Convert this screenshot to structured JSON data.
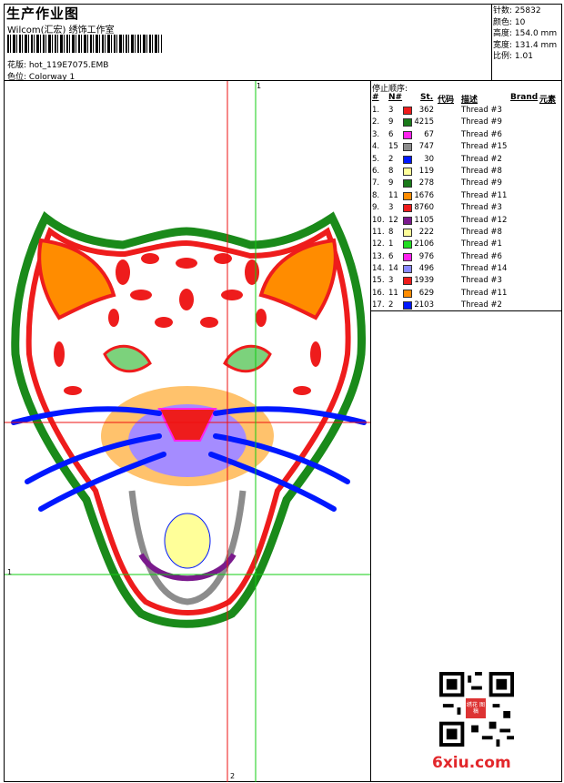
{
  "header": {
    "title": "生产作业图",
    "studio": "Wilcom(汇宏) 绣饰工作室",
    "design_label": "花版:",
    "design_file": "hot_119E7075.EMB",
    "colorway_label": "色位:",
    "colorway": "Colorway 1"
  },
  "stats": [
    {
      "label": "针数:",
      "value": "25832"
    },
    {
      "label": "颜色:",
      "value": "10"
    },
    {
      "label": "高度:",
      "value": "154.0 mm"
    },
    {
      "label": "宽度:",
      "value": "131.4 mm"
    },
    {
      "label": "比例:",
      "value": "1.01"
    }
  ],
  "sequence": {
    "title": "停止顺序:",
    "headers": {
      "num": "#",
      "n": "N#",
      "st": "St.",
      "code": "代码",
      "desc": "描述",
      "brand": "Brand",
      "elem": "元素"
    },
    "rows": [
      {
        "num": "1.",
        "n": "3",
        "color": "#ee1c1c",
        "st": "362",
        "desc": "Thread #3"
      },
      {
        "num": "2.",
        "n": "9",
        "color": "#1a7a1a",
        "st": "4215",
        "desc": "Thread #9"
      },
      {
        "num": "3.",
        "n": "6",
        "color": "#ff22ee",
        "st": "67",
        "desc": "Thread #6"
      },
      {
        "num": "4.",
        "n": "15",
        "color": "#8c8c8c",
        "st": "747",
        "desc": "Thread #15"
      },
      {
        "num": "5.",
        "n": "2",
        "color": "#0018ff",
        "st": "30",
        "desc": "Thread #2"
      },
      {
        "num": "6.",
        "n": "8",
        "color": "#ffff99",
        "st": "119",
        "desc": "Thread #8"
      },
      {
        "num": "7.",
        "n": "9",
        "color": "#1a7a1a",
        "st": "278",
        "desc": "Thread #9"
      },
      {
        "num": "8.",
        "n": "11",
        "color": "#ff8c00",
        "st": "1676",
        "desc": "Thread #11"
      },
      {
        "num": "9.",
        "n": "3",
        "color": "#ee1c1c",
        "st": "8760",
        "desc": "Thread #3"
      },
      {
        "num": "10.",
        "n": "12",
        "color": "#7a1a8c",
        "st": "1105",
        "desc": "Thread #12"
      },
      {
        "num": "11.",
        "n": "8",
        "color": "#ffff99",
        "st": "222",
        "desc": "Thread #8"
      },
      {
        "num": "12.",
        "n": "1",
        "color": "#22dd22",
        "st": "2106",
        "desc": "Thread #1"
      },
      {
        "num": "13.",
        "n": "6",
        "color": "#ff22ee",
        "st": "976",
        "desc": "Thread #6"
      },
      {
        "num": "14.",
        "n": "14",
        "color": "#8888ff",
        "st": "496",
        "desc": "Thread #14"
      },
      {
        "num": "15.",
        "n": "3",
        "color": "#ee1c1c",
        "st": "1939",
        "desc": "Thread #3"
      },
      {
        "num": "16.",
        "n": "11",
        "color": "#ff8c00",
        "st": "629",
        "desc": "Thread #11"
      },
      {
        "num": "17.",
        "n": "2",
        "color": "#0018ff",
        "st": "2103",
        "desc": "Thread #2"
      }
    ]
  },
  "guides": {
    "top_h": "1",
    "left_v": "1",
    "bottom_h": "2"
  },
  "watermark": "6xiu.com",
  "qr_stamp": "绣花 图稿",
  "colors": {
    "guide_red": "#ee1111",
    "guide_green": "#11cc11"
  }
}
